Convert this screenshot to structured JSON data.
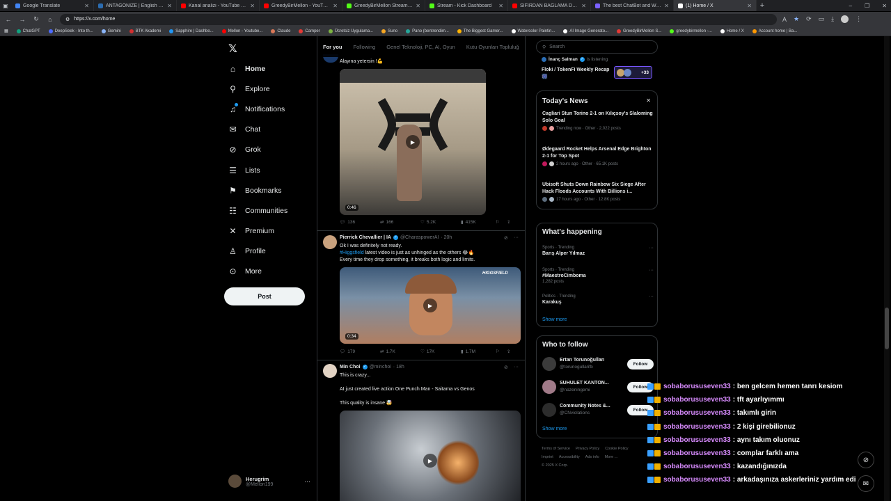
{
  "browser": {
    "tabs": [
      {
        "title": "Google Translate",
        "color": "#4285f4"
      },
      {
        "title": "ANTAGONIZE | English meaning",
        "color": "#2b6cb0"
      },
      {
        "title": "Kanal analizi - YouTube Studio",
        "color": "#ff0000"
      },
      {
        "title": "GreedyBirMellon - YouTube",
        "color": "#ff0000"
      },
      {
        "title": "GreedyBirMellon Stream - Watch",
        "color": "#53fc18"
      },
      {
        "title": "Stream - Kick Dashboard",
        "color": "#53fc18"
      },
      {
        "title": "SIFIRDAN BAĞLAMA DERSİ 3 (EN",
        "color": "#ff0000"
      },
      {
        "title": "The best ChatBot and Widgets for",
        "color": "#7b61ff"
      },
      {
        "title": "(1) Home / X",
        "color": "#ffffff"
      }
    ],
    "url": "https://x.com/home",
    "bookmarks": [
      {
        "label": "ChatGPT",
        "color": "#10a37f"
      },
      {
        "label": "DeepSeek - Into th...",
        "color": "#4d6bfe"
      },
      {
        "label": "Gemini",
        "color": "#8ab4f8"
      },
      {
        "label": "BTK Akademi",
        "color": "#d32f2f"
      },
      {
        "label": "Sapphire | Dashbo...",
        "color": "#2196f3"
      },
      {
        "label": "Mellon - Youtube...",
        "color": "#ff0000"
      },
      {
        "label": "Claude",
        "color": "#d97757"
      },
      {
        "label": "Camper",
        "color": "#e53935"
      },
      {
        "label": "Ücretsiz Uygulama...",
        "color": "#7cb342"
      },
      {
        "label": "Suno",
        "color": "#f5a623"
      },
      {
        "label": "Pano (bentrendim...",
        "color": "#26a69a"
      },
      {
        "label": "The Biggest Gamer...",
        "color": "#ffb300"
      },
      {
        "label": "Watercolor Paintin...",
        "color": "#ffffff"
      },
      {
        "label": "AI Image Generato...",
        "color": "#ffffff"
      },
      {
        "label": "GreedyBirMellon S...",
        "color": "#e53935"
      },
      {
        "label": "greedybirmellon -...",
        "color": "#53fc18"
      },
      {
        "label": "Home / X",
        "color": "#ffffff"
      },
      {
        "label": "Account home | Ba...",
        "color": "#ff9800"
      }
    ]
  },
  "nav": {
    "items": [
      {
        "label": "Home",
        "icon": "home-icon",
        "glyph": "⌂"
      },
      {
        "label": "Explore",
        "icon": "search-icon",
        "glyph": "⚲"
      },
      {
        "label": "Notifications",
        "icon": "bell-icon",
        "glyph": "♫"
      },
      {
        "label": "Chat",
        "icon": "mail-icon",
        "glyph": "✉"
      },
      {
        "label": "Grok",
        "icon": "grok-icon",
        "glyph": "⊘"
      },
      {
        "label": "Lists",
        "icon": "list-icon",
        "glyph": "☰"
      },
      {
        "label": "Bookmarks",
        "icon": "bookmark-icon",
        "glyph": "⚑"
      },
      {
        "label": "Communities",
        "icon": "people-icon",
        "glyph": "☷"
      },
      {
        "label": "Premium",
        "icon": "x-icon",
        "glyph": "✕"
      },
      {
        "label": "Profile",
        "icon": "person-icon",
        "glyph": "♙"
      },
      {
        "label": "More",
        "icon": "more-icon",
        "glyph": "⊙"
      }
    ],
    "post_label": "Post",
    "me": {
      "name": "Herugrim",
      "handle": "@Mellon199"
    }
  },
  "feed": {
    "tabs": [
      "For you",
      "Following",
      "Genel Teknoloji, PC, AI, Oyun",
      "Kutu Oyunları Topluluğ"
    ],
    "tweets": [
      {
        "text": "Alayına yetersin !💪",
        "duration": "0:46",
        "stats": {
          "replies": "136",
          "reposts": "166",
          "likes": "5.2K",
          "views": "415K"
        }
      },
      {
        "name": "Pierrick Chevallier | IA",
        "handle": "@CharaspowerAI",
        "time": "· 20h",
        "line1": "Ok I was definitely not ready.",
        "link": "#Higgsfield",
        "line2": " latest video is just as unhinged as the others 😂🔥",
        "line3": "Every time they drop something, it breaks both logic and limits.",
        "watermark": "HIGGSFIELD",
        "duration": "0:34",
        "stats": {
          "replies": "179",
          "reposts": "1.7K",
          "likes": "17K",
          "views": "1.7M"
        }
      },
      {
        "name": "Min Choi",
        "handle": "@minchoi",
        "time": "· 18h",
        "line1": "This is crazy...",
        "line2": "AI just created live action One Punch Man - Saitama vs Genos",
        "line3": "This quality is insane 🤯"
      }
    ]
  },
  "right": {
    "search_placeholder": "Search",
    "spaces": {
      "host": "İnanç Salman",
      "status": "is listening",
      "title": "Floki / TokenFi Weekly Recap 🎆",
      "count": "+33"
    },
    "news": {
      "title": "Today's News",
      "items": [
        {
          "title": "Cagliari Stun Torino 2-1 on Kılıçsoy's Slaloming Solo Goal",
          "meta": "Trending now · Other · 2,022 posts"
        },
        {
          "title": "Ødegaard Rocket Helps Arsenal Edge Brighton 2-1 for Top Spot",
          "meta": "2 hours ago · Other · 65.1K posts"
        },
        {
          "title": "Ubisoft Shuts Down Rainbow Six Siege After Hack Floods Accounts With Billions i...",
          "meta": "17 hours ago · Other · 12.8K posts"
        }
      ]
    },
    "happening": {
      "title": "What's happening",
      "trends": [
        {
          "ctx": "Sports · Trending",
          "name": "Barış Alper Yılmaz",
          "posts": ""
        },
        {
          "ctx": "Sports · Trending",
          "name": "#MaestroCimboma",
          "posts": "1,282 posts"
        },
        {
          "ctx": "Politics · Trending",
          "name": "Karakuş",
          "posts": ""
        }
      ],
      "show_more": "Show more"
    },
    "follow": {
      "title": "Who to follow",
      "people": [
        {
          "name": "Ertan Torunoğulları",
          "handle": "@torunogullarifb",
          "button": "Follow"
        },
        {
          "name": "SUHULET KANTON...",
          "handle": "@nazeningemi",
          "button": "Follow"
        },
        {
          "name": "Community Notes &...",
          "handle": "@CNviolations",
          "button": "Follow"
        }
      ],
      "show_more": "Show more"
    },
    "footer": [
      "Terms of Service",
      "Privacy Policy",
      "Cookie Policy",
      "Imprint",
      "Accessibility",
      "Ads info",
      "More ...",
      "© 2025 X Corp."
    ]
  },
  "chat": {
    "messages": [
      {
        "user": "sobaborususeven33",
        "text": ": ben gelcem hemen tanrı kesiom"
      },
      {
        "user": "sobaborususeven33",
        "text": ": tft ayarlıyımmı"
      },
      {
        "user": "sobaborususeven33",
        "text": ": takımlı girin"
      },
      {
        "user": "sobaborususeven33",
        "text": ": 2 kişi girebilionuz"
      },
      {
        "user": "sobaborususeven33",
        "text": ": aynı takım oluonuz"
      },
      {
        "user": "sobaborususeven33",
        "text": ": complar farklı ama"
      },
      {
        "user": "sobaborususeven33",
        "text": ": kazandığınızda"
      },
      {
        "user": "sobaborususeven33",
        "text": ": arkadaşınıza askerleriniz yardım edi"
      }
    ]
  }
}
